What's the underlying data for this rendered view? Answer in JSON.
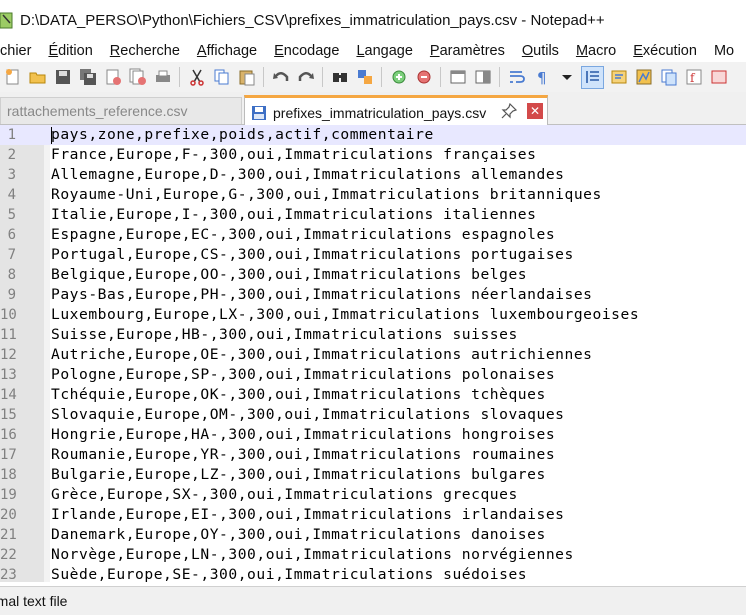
{
  "window": {
    "title": "D:\\DATA_PERSO\\Python\\Fichiers_CSV\\prefixes_immatriculation_pays.csv - Notepad++"
  },
  "menu": {
    "items": [
      {
        "label": "chier"
      },
      {
        "label": "Édition"
      },
      {
        "label": "Recherche"
      },
      {
        "label": "Affichage"
      },
      {
        "label": "Encodage"
      },
      {
        "label": "Langage"
      },
      {
        "label": "Paramètres"
      },
      {
        "label": "Outils"
      },
      {
        "label": "Macro"
      },
      {
        "label": "Exécution"
      },
      {
        "label": "Mo"
      }
    ]
  },
  "toolbar": {
    "icons": [
      "new-file-icon",
      "open-file-icon",
      "save-icon",
      "save-all-icon",
      "close-icon",
      "close-all-icon",
      "print-icon",
      "cut-icon",
      "copy-icon",
      "paste-icon",
      "undo-icon",
      "redo-icon",
      "find-icon",
      "replace-icon",
      "zoom-in-icon",
      "zoom-out-icon",
      "sync-vertical-icon",
      "sync-horizontal-icon",
      "word-wrap-icon",
      "show-all-chars-icon",
      "dropdown-icon",
      "indent-guide-icon",
      "function-list-icon",
      "document-map-icon",
      "folder-workspace-icon",
      "macro-record-icon",
      "macro-stop-icon"
    ]
  },
  "tabs": [
    {
      "label": "rattachements_reference.csv",
      "active": false
    },
    {
      "label": "prefixes_immatriculation_pays.csv",
      "active": true
    }
  ],
  "editor": {
    "lines": [
      {
        "n": "1",
        "text": "pays,zone,prefixe,poids,actif,commentaire"
      },
      {
        "n": "2",
        "text": "France,Europe,F-,300,oui,Immatriculations françaises"
      },
      {
        "n": "3",
        "text": "Allemagne,Europe,D-,300,oui,Immatriculations allemandes"
      },
      {
        "n": "4",
        "text": "Royaume-Uni,Europe,G-,300,oui,Immatriculations britanniques"
      },
      {
        "n": "5",
        "text": "Italie,Europe,I-,300,oui,Immatriculations italiennes"
      },
      {
        "n": "6",
        "text": "Espagne,Europe,EC-,300,oui,Immatriculations espagnoles"
      },
      {
        "n": "7",
        "text": "Portugal,Europe,CS-,300,oui,Immatriculations portugaises"
      },
      {
        "n": "8",
        "text": "Belgique,Europe,OO-,300,oui,Immatriculations belges"
      },
      {
        "n": "9",
        "text": "Pays-Bas,Europe,PH-,300,oui,Immatriculations néerlandaises"
      },
      {
        "n": "10",
        "text": "Luxembourg,Europe,LX-,300,oui,Immatriculations luxembourgeoises"
      },
      {
        "n": "11",
        "text": "Suisse,Europe,HB-,300,oui,Immatriculations suisses"
      },
      {
        "n": "12",
        "text": "Autriche,Europe,OE-,300,oui,Immatriculations autrichiennes"
      },
      {
        "n": "13",
        "text": "Pologne,Europe,SP-,300,oui,Immatriculations polonaises"
      },
      {
        "n": "14",
        "text": "Tchéquie,Europe,OK-,300,oui,Immatriculations tchèques"
      },
      {
        "n": "15",
        "text": "Slovaquie,Europe,OM-,300,oui,Immatriculations slovaques"
      },
      {
        "n": "16",
        "text": "Hongrie,Europe,HA-,300,oui,Immatriculations hongroises"
      },
      {
        "n": "17",
        "text": "Roumanie,Europe,YR-,300,oui,Immatriculations roumaines"
      },
      {
        "n": "18",
        "text": "Bulgarie,Europe,LZ-,300,oui,Immatriculations bulgares"
      },
      {
        "n": "19",
        "text": "Grèce,Europe,SX-,300,oui,Immatriculations grecques"
      },
      {
        "n": "20",
        "text": "Irlande,Europe,EI-,300,oui,Immatriculations irlandaises"
      },
      {
        "n": "21",
        "text": "Danemark,Europe,OY-,300,oui,Immatriculations danoises"
      },
      {
        "n": "22",
        "text": "Norvège,Europe,LN-,300,oui,Immatriculations norvégiennes"
      },
      {
        "n": "23",
        "text": "Suède,Europe,SE-,300,oui,Immatriculations suédoises"
      }
    ]
  },
  "status": {
    "file_type": "rmal text file"
  }
}
